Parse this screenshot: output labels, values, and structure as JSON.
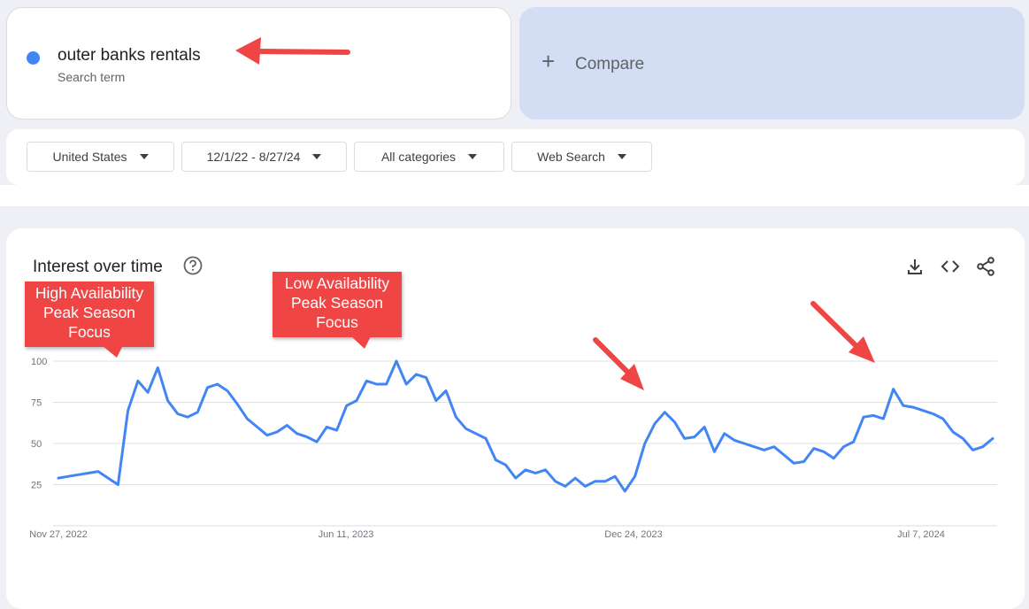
{
  "search_term": {
    "label": "outer banks rentals",
    "sublabel": "Search term",
    "dot_color": "#4285f4"
  },
  "compare": {
    "icon": "plus-icon",
    "label": "Compare"
  },
  "filters": [
    {
      "label": "United States"
    },
    {
      "label": "12/1/22 - 8/27/24"
    },
    {
      "label": "All categories"
    },
    {
      "label": "Web Search"
    }
  ],
  "chart_header": {
    "title": "Interest over time",
    "help_icon": "help-circle-icon",
    "actions": [
      "download-icon",
      "embed-code-icon",
      "share-icon"
    ]
  },
  "annotations": [
    {
      "text": "High Availability\nPeak Season\nFocus",
      "color": "#f04545"
    },
    {
      "text": "Low Availability\nPeak Season\nFocus",
      "color": "#f04545"
    }
  ],
  "chart_data": {
    "type": "line",
    "ylim": [
      0,
      100
    ],
    "yticks": [
      25,
      50,
      75,
      100
    ],
    "grid": true,
    "xtick_labels": [
      "Nov 27, 2022",
      "Jun 11, 2023",
      "Dec 24, 2023",
      "Jul 7, 2024"
    ],
    "series": [
      {
        "color": "#4285f4",
        "values": [
          29,
          30,
          31,
          32,
          33,
          29,
          25,
          70,
          88,
          81,
          96,
          76,
          68,
          66,
          69,
          84,
          86,
          82,
          74,
          65,
          60,
          55,
          57,
          61,
          56,
          54,
          51,
          60,
          58,
          73,
          76,
          88,
          86,
          86,
          100,
          86,
          92,
          90,
          76,
          82,
          66,
          59,
          56,
          53,
          40,
          37,
          29,
          34,
          32,
          34,
          27,
          24,
          29,
          24,
          27,
          27,
          30,
          21,
          30,
          50,
          62,
          69,
          63,
          53,
          54,
          60,
          45,
          56,
          52,
          50,
          48,
          46,
          48,
          43,
          38,
          39,
          47,
          45,
          41,
          48,
          51,
          66,
          67,
          65,
          83,
          73,
          72,
          70,
          68,
          65,
          57,
          53,
          46,
          48,
          53
        ]
      }
    ]
  }
}
